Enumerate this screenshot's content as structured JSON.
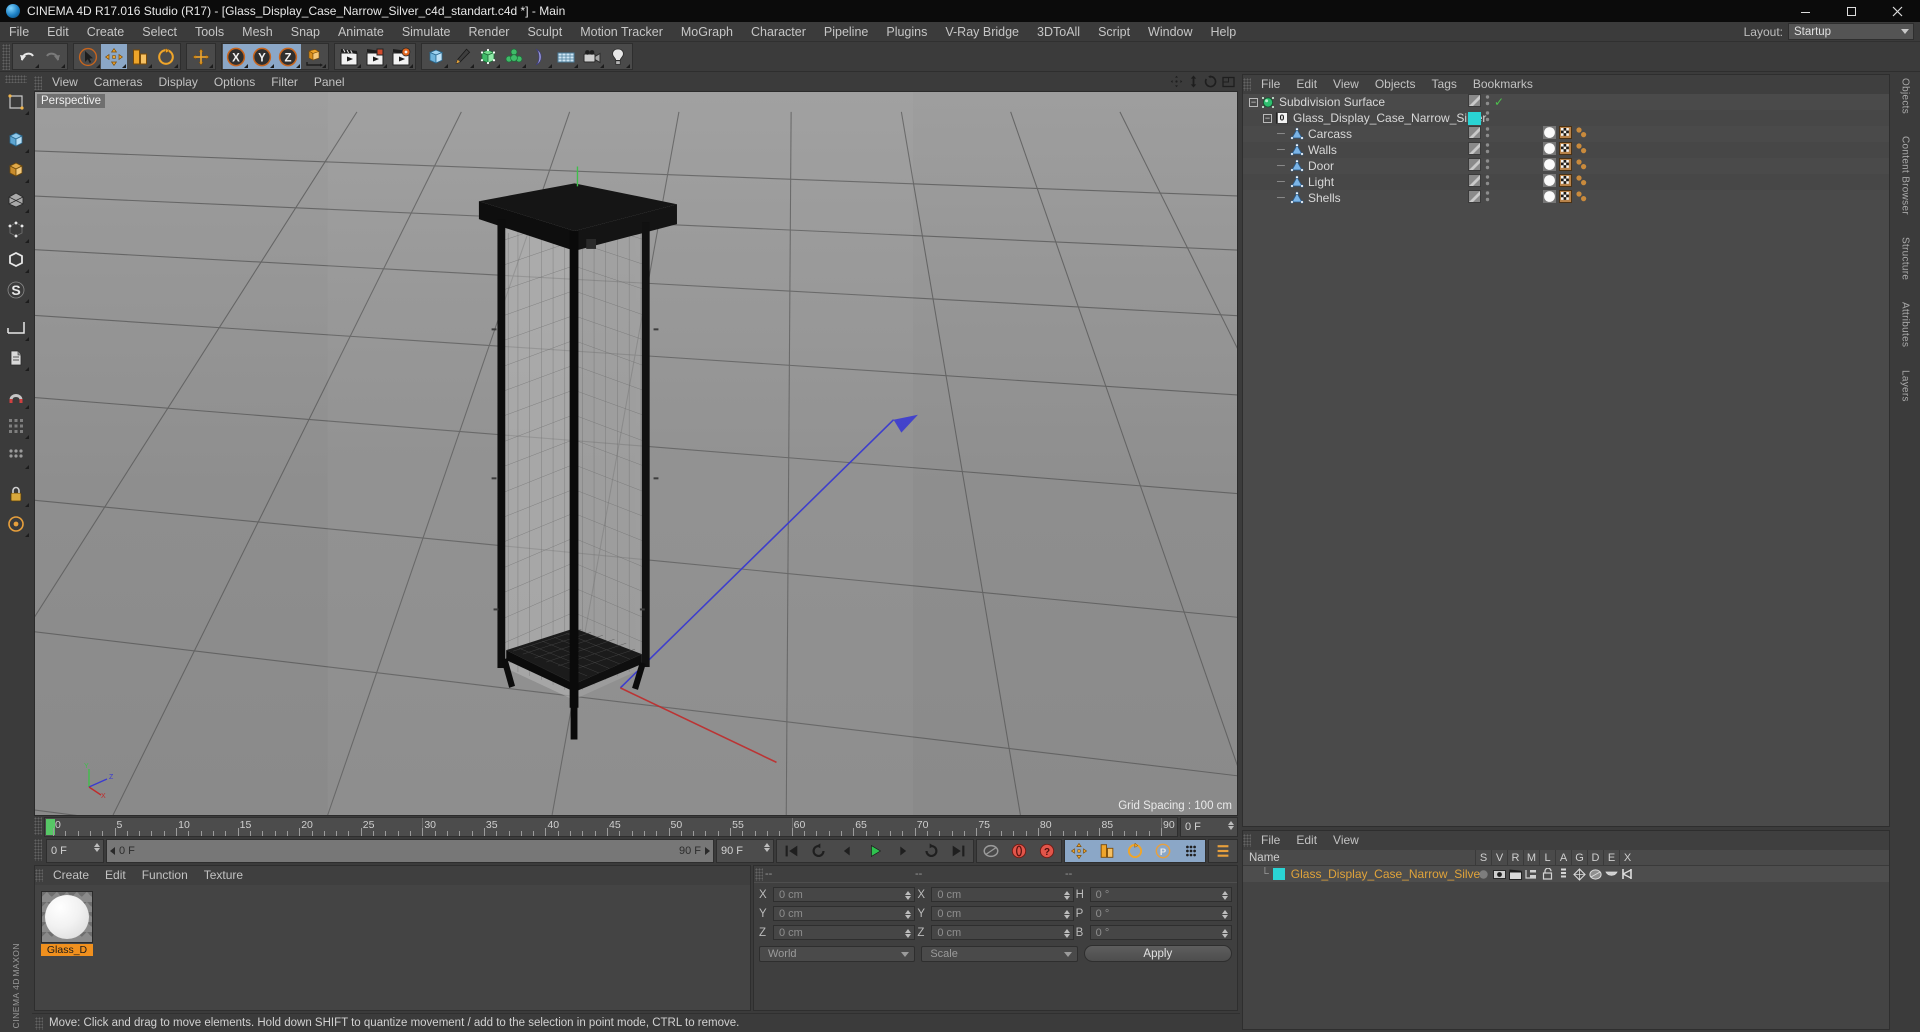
{
  "titlebar": {
    "title": "CINEMA 4D R17.016 Studio (R17) - [Glass_Display_Case_Narrow_Silver_c4d_standart.c4d *] - Main",
    "minimize": "minimize-button",
    "maximize": "maximize-button",
    "close": "close-button"
  },
  "menubar": {
    "items": [
      "File",
      "Edit",
      "Create",
      "Select",
      "Tools",
      "Mesh",
      "Snap",
      "Animate",
      "Simulate",
      "Render",
      "Sculpt",
      "Motion Tracker",
      "MoGraph",
      "Character",
      "Pipeline",
      "Plugins",
      "V-Ray Bridge",
      "3DToAll",
      "Script",
      "Window",
      "Help"
    ],
    "layout_label": "Layout:",
    "layout_value": "Startup"
  },
  "toolbar": {
    "groups": [
      {
        "name": "undo-redo",
        "buttons": [
          {
            "name": "undo-button",
            "icon": "undo-arrow",
            "selected": false
          },
          {
            "name": "redo-button",
            "icon": "redo-arrow",
            "selected": false,
            "disabled": true
          }
        ]
      },
      {
        "name": "transform-tools",
        "buttons": [
          {
            "name": "select-tool",
            "icon": "cursor-arrow",
            "selected": false
          },
          {
            "name": "move-tool",
            "icon": "move-cross",
            "selected": true
          },
          {
            "name": "scale-tool",
            "icon": "scale-box",
            "selected": false
          },
          {
            "name": "rotate-tool",
            "icon": "rotate-circle",
            "selected": false
          }
        ]
      },
      {
        "name": "world-axis",
        "buttons": [
          {
            "name": "global-local-toggle",
            "icon": "plus-cross",
            "selected": false
          }
        ]
      },
      {
        "name": "axis-locks",
        "buttons": [
          {
            "name": "lock-x-axis",
            "icon": "x-letter",
            "selected": true
          },
          {
            "name": "lock-y-axis",
            "icon": "y-letter",
            "selected": true
          },
          {
            "name": "lock-z-axis",
            "icon": "z-letter",
            "selected": true
          },
          {
            "name": "world-coordinate-system",
            "icon": "cube-axis",
            "selected": false
          }
        ]
      },
      {
        "name": "render-group",
        "buttons": [
          {
            "name": "render-view-button",
            "icon": "clapper",
            "selected": false
          },
          {
            "name": "render-to-picture-viewer-button",
            "icon": "clapper-picture",
            "selected": false
          },
          {
            "name": "render-settings-button",
            "icon": "clapper-gear",
            "selected": false
          }
        ]
      },
      {
        "name": "create-group",
        "buttons": [
          {
            "name": "add-cube-button",
            "icon": "cube",
            "selected": false
          },
          {
            "name": "add-spline-button",
            "icon": "pen",
            "selected": false
          },
          {
            "name": "add-generator-button",
            "icon": "generator",
            "selected": false
          },
          {
            "name": "add-mograph-button",
            "icon": "mograph",
            "selected": false
          },
          {
            "name": "add-deformer-button",
            "icon": "bend-deformer",
            "selected": false
          },
          {
            "name": "add-environment-button",
            "icon": "floor",
            "selected": false
          },
          {
            "name": "add-camera-button",
            "icon": "camera",
            "selected": false
          },
          {
            "name": "add-light-button",
            "icon": "lightbulb",
            "selected": false
          }
        ]
      }
    ]
  },
  "leftbar": {
    "items": [
      {
        "name": "make-editable-button",
        "icon": "make-editable"
      },
      {
        "name": "model-mode-button",
        "icon": "model-cube"
      },
      {
        "name": "texture-mode-button",
        "icon": "texture-axis"
      },
      {
        "name": "polygon-mode-button",
        "icon": "polygon"
      },
      {
        "name": "point-mode-button",
        "icon": "points"
      },
      {
        "name": "edge-mode-button",
        "icon": "edges"
      },
      {
        "name": "object-axis-mode-button",
        "icon": "object-axis"
      },
      {
        "name": "workplane-button",
        "icon": "workplane"
      },
      {
        "name": "viewport-solo-button",
        "icon": "viewport-solo"
      },
      {
        "name": "enable-snap-button",
        "icon": "snap-magnet"
      },
      {
        "name": "enable-axis-button",
        "icon": "axis-lock"
      },
      {
        "name": "layout-grid-button",
        "icon": "grid-dots"
      },
      {
        "name": "lock-button",
        "icon": "padlock"
      },
      {
        "name": "uv-mode-button",
        "icon": "uv-circle"
      }
    ],
    "brand_top": "MAXON",
    "brand_bottom": "CINEMA 4D"
  },
  "viewport": {
    "menu": [
      "View",
      "Cameras",
      "Display",
      "Options",
      "Filter",
      "Panel"
    ],
    "label": "Perspective",
    "grid_spacing": "Grid Spacing : 100 cm",
    "nav_icons": [
      "pan-icon",
      "dolly-icon",
      "rotate-icon",
      "maximize-view-icon"
    ],
    "axis_labels": {
      "x": "X",
      "y": "Y",
      "z": "Z"
    }
  },
  "timeline": {
    "ticks": [
      0,
      5,
      10,
      15,
      20,
      25,
      30,
      35,
      40,
      45,
      50,
      55,
      60,
      65,
      70,
      75,
      80,
      85,
      90
    ],
    "start_frame": "0 F",
    "end_frame_right": "90 F",
    "current_frame": "0 F",
    "range_left": "0 F",
    "range_right": "90 F",
    "preview_end": "90 F",
    "frame_field": "0 F",
    "transport": [
      {
        "name": "go-to-start-button",
        "icon": "skip-back"
      },
      {
        "name": "play-backwards-button",
        "icon": "rewind-loop"
      },
      {
        "name": "previous-frame-button",
        "icon": "step-back"
      },
      {
        "name": "play-forwards-button",
        "icon": "play"
      },
      {
        "name": "next-frame-button",
        "icon": "step-forward"
      },
      {
        "name": "play-loop-button",
        "icon": "loop"
      },
      {
        "name": "go-to-end-button",
        "icon": "skip-forward"
      }
    ],
    "record_group": [
      {
        "name": "autokeying-button",
        "icon": "key"
      },
      {
        "name": "record-active-objects-button",
        "icon": "record-red"
      },
      {
        "name": "autokeying-toggle-button",
        "icon": "question-red"
      }
    ],
    "key_group": [
      {
        "name": "position-key-button",
        "icon": "move-cross",
        "selected": true
      },
      {
        "name": "scale-key-button",
        "icon": "scale-box",
        "selected": true
      },
      {
        "name": "rotation-key-button",
        "icon": "rotate-circle",
        "selected": true
      },
      {
        "name": "parameter-key-button",
        "icon": "p-letter",
        "selected": true
      },
      {
        "name": "point-level-animation-button",
        "icon": "pla-dots",
        "selected": true
      }
    ],
    "extra_group": [
      {
        "name": "keyframe-selection-button",
        "icon": "keyframe-bars"
      }
    ]
  },
  "material_manager": {
    "menu": [
      "Create",
      "Edit",
      "Function",
      "Texture"
    ],
    "materials": [
      {
        "name": "Glass_D",
        "selected": true
      }
    ]
  },
  "coordinate_manager": {
    "header": [
      "--",
      "--",
      "--"
    ],
    "rows": [
      {
        "axis1": "X",
        "value1": "0 cm",
        "axis2": "X",
        "value2": "0 cm",
        "axis3": "H",
        "value3": "0 °"
      },
      {
        "axis1": "Y",
        "value1": "0 cm",
        "axis2": "Y",
        "value2": "0 cm",
        "axis3": "P",
        "value3": "0 °"
      },
      {
        "axis1": "Z",
        "value1": "0 cm",
        "axis2": "Z",
        "value2": "0 cm",
        "axis3": "B",
        "value3": "0 °"
      }
    ],
    "system": "World",
    "mode": "Scale",
    "apply": "Apply"
  },
  "statusbar": {
    "message": "Move: Click and drag to move elements. Hold down SHIFT to quantize movement / add to the selection in point mode, CTRL to remove."
  },
  "object_manager": {
    "menu": [
      "File",
      "Edit",
      "View",
      "Objects",
      "Tags",
      "Bookmarks"
    ],
    "rows": [
      {
        "label": "Subdivision Surface",
        "icon": "subdivision-surface-icon",
        "depth": 0,
        "expander": "minus",
        "visdots": true,
        "check": true,
        "tags": []
      },
      {
        "label": "Glass_Display_Case_Narrow_Silver",
        "icon": "null-object-icon",
        "depth": 1,
        "expander": "minus",
        "swatch": "#2ad4d4",
        "tags": []
      },
      {
        "label": "Carcass",
        "icon": "polygon-object-icon",
        "depth": 2,
        "expander": "none",
        "tags": [
          "material-tag",
          "uvw-tag",
          "selection-tag"
        ]
      },
      {
        "label": "Walls",
        "icon": "polygon-object-icon",
        "depth": 2,
        "expander": "none",
        "tags": [
          "material-tag",
          "uvw-tag",
          "selection-tag"
        ]
      },
      {
        "label": "Door",
        "icon": "polygon-object-icon",
        "depth": 2,
        "expander": "none",
        "tags": [
          "material-tag",
          "uvw-tag",
          "selection-tag"
        ]
      },
      {
        "label": "Light",
        "icon": "polygon-object-icon",
        "depth": 2,
        "expander": "none",
        "tags": [
          "material-tag",
          "uvw-tag",
          "selection-tag"
        ]
      },
      {
        "label": "Shells",
        "icon": "polygon-object-icon",
        "depth": 2,
        "expander": "none",
        "tags": [
          "material-tag",
          "uvw-tag",
          "selection-tag"
        ]
      }
    ]
  },
  "layer_manager": {
    "menu": [
      "File",
      "Edit",
      "View"
    ],
    "name_header": "Name",
    "columns": [
      "S",
      "V",
      "R",
      "M",
      "L",
      "A",
      "G",
      "D",
      "E",
      "X"
    ],
    "rows": [
      {
        "label": "Glass_Display_Case_Narrow_Silver",
        "swatch": "#2ad4d4"
      }
    ]
  },
  "right_dock_tabs": [
    "Objects",
    "Content Browser",
    "Structure",
    "Attributes",
    "Layers"
  ],
  "colors": {
    "accent_blue": "#8ba7c7",
    "orange": "#f0901e",
    "cyan_swatch": "#2ad4d4",
    "green_check": "#4cc24c",
    "panel_bg": "#3b3b3b",
    "list_bg": "#4a4a4a"
  }
}
